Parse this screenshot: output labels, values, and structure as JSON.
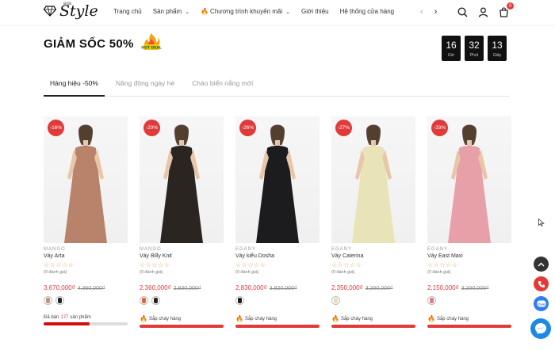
{
  "header": {
    "logo_text": "Style",
    "logo_sup": "ega",
    "nav": [
      {
        "label": "Trang chủ",
        "has_dropdown": false,
        "hot": false
      },
      {
        "label": "Sản phẩm",
        "has_dropdown": true,
        "hot": false
      },
      {
        "label": "Chương trình khuyến mãi",
        "has_dropdown": true,
        "hot": true
      },
      {
        "label": "Giới thiệu",
        "has_dropdown": false,
        "hot": false
      },
      {
        "label": "Hệ thống cửa hàng",
        "has_dropdown": false,
        "hot": false
      }
    ],
    "cart_count": "0",
    "icons": [
      "search-icon",
      "user-icon",
      "cart-icon"
    ]
  },
  "section": {
    "title": "GIẢM SỐC 50%",
    "hot_badge": "HOT DEAL",
    "countdown": [
      {
        "value": "16",
        "label": "Giờ"
      },
      {
        "value": "32",
        "label": "Phút"
      },
      {
        "value": "13",
        "label": "Giây"
      }
    ]
  },
  "tabs": [
    {
      "label": "Hàng hiệu -50%",
      "active": true
    },
    {
      "label": "Năng động ngày hè",
      "active": false
    },
    {
      "label": "Chào biển nắng mới",
      "active": false
    }
  ],
  "products": [
    {
      "discount": "-16%",
      "brand": "MANGO",
      "name": "Váy Arta",
      "stars": "☆☆☆☆☆",
      "reviews": "(0 đánh giá)",
      "price": "3,670,000₫",
      "old_price": "4,360,000₫",
      "swatches": [
        "#c8907a",
        "#222222"
      ],
      "sold_text": "Đã bán",
      "sold_count": "177",
      "sold_unit": "sản phẩm",
      "sold_fraction": 0.55,
      "image_color": "#b9826a"
    },
    {
      "discount": "-20%",
      "brand": "MANGO",
      "name": "Váy Billy Knit",
      "stars": "☆☆☆☆☆",
      "reviews": "(0 đánh giá)",
      "price": "2,360,000₫",
      "old_price": "2,930,000₫",
      "swatches": [
        "#d96a2e",
        "#222222"
      ],
      "sold_text": "Sắp cháy hàng",
      "image_color": "#2a2521"
    },
    {
      "discount": "-26%",
      "brand": "EGANY",
      "name": "Váy kiểu Dosha",
      "stars": "☆☆☆☆☆",
      "reviews": "(0 đánh giá)",
      "price": "2,830,000₫",
      "old_price": "3,820,000₫",
      "swatches": [
        "#1a1a1a"
      ],
      "sold_text": "Sắp cháy hàng",
      "image_color": "#1c1c1e"
    },
    {
      "discount": "-27%",
      "brand": "EGANY",
      "name": "Váy Caterina",
      "stars": "☆☆☆☆☆",
      "reviews": "(0 đánh giá)",
      "price": "2,350,000₫",
      "old_price": "3,200,000₫",
      "swatches": [
        "#e6dfb6"
      ],
      "sold_text": "Sắp cháy hàng",
      "image_color": "#e9e3b8"
    },
    {
      "discount": "-33%",
      "brand": "EGANY",
      "name": "Váy East Maxi",
      "stars": "☆☆☆☆☆",
      "reviews": "(0 đánh giá)",
      "price": "2,150,000₫",
      "old_price": "3,200,000₫",
      "swatches": [
        "#e07a86"
      ],
      "sold_text": "Sắp cháy hàng",
      "image_color": "#e8a0a8"
    }
  ],
  "floating": [
    "back-to-top-icon",
    "phone-icon",
    "zalo-icon",
    "messenger-icon"
  ],
  "colors": {
    "accent": "#e03a3a",
    "dark": "#111111",
    "star": "#e8a23c"
  }
}
